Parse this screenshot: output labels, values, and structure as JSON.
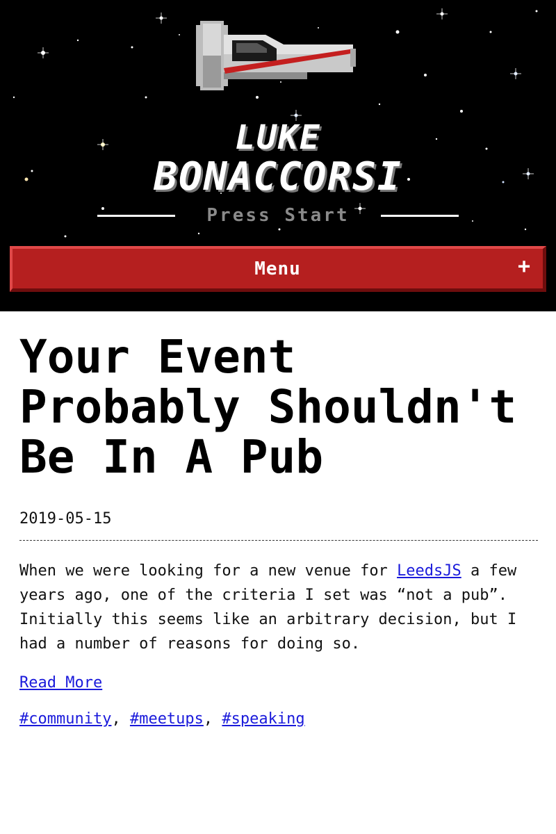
{
  "header": {
    "title_line1": "LUKE",
    "title_line2": "BONACCORSI",
    "tagline": "Press Start",
    "logo_icon": "spaceship-icon",
    "colors": {
      "background": "#000000",
      "menu_red": "#b51f1f"
    }
  },
  "menu": {
    "label": "Menu",
    "toggle_icon": "+"
  },
  "post": {
    "title": "Your Event Probably Shouldn't Be In A Pub",
    "date": "2019-05-15",
    "excerpt": {
      "before_link": "When we were looking for a new venue for ",
      "link_text": "LeedsJS",
      "after_link": " a few years ago, one of the criteria I set was “not a pub”. Initially this seems like an arbitrary decision, but I had a number of reasons for doing so."
    },
    "read_more": "Read More",
    "tags": [
      "#community",
      "#meetups",
      "#speaking"
    ],
    "tag_separator": ","
  }
}
